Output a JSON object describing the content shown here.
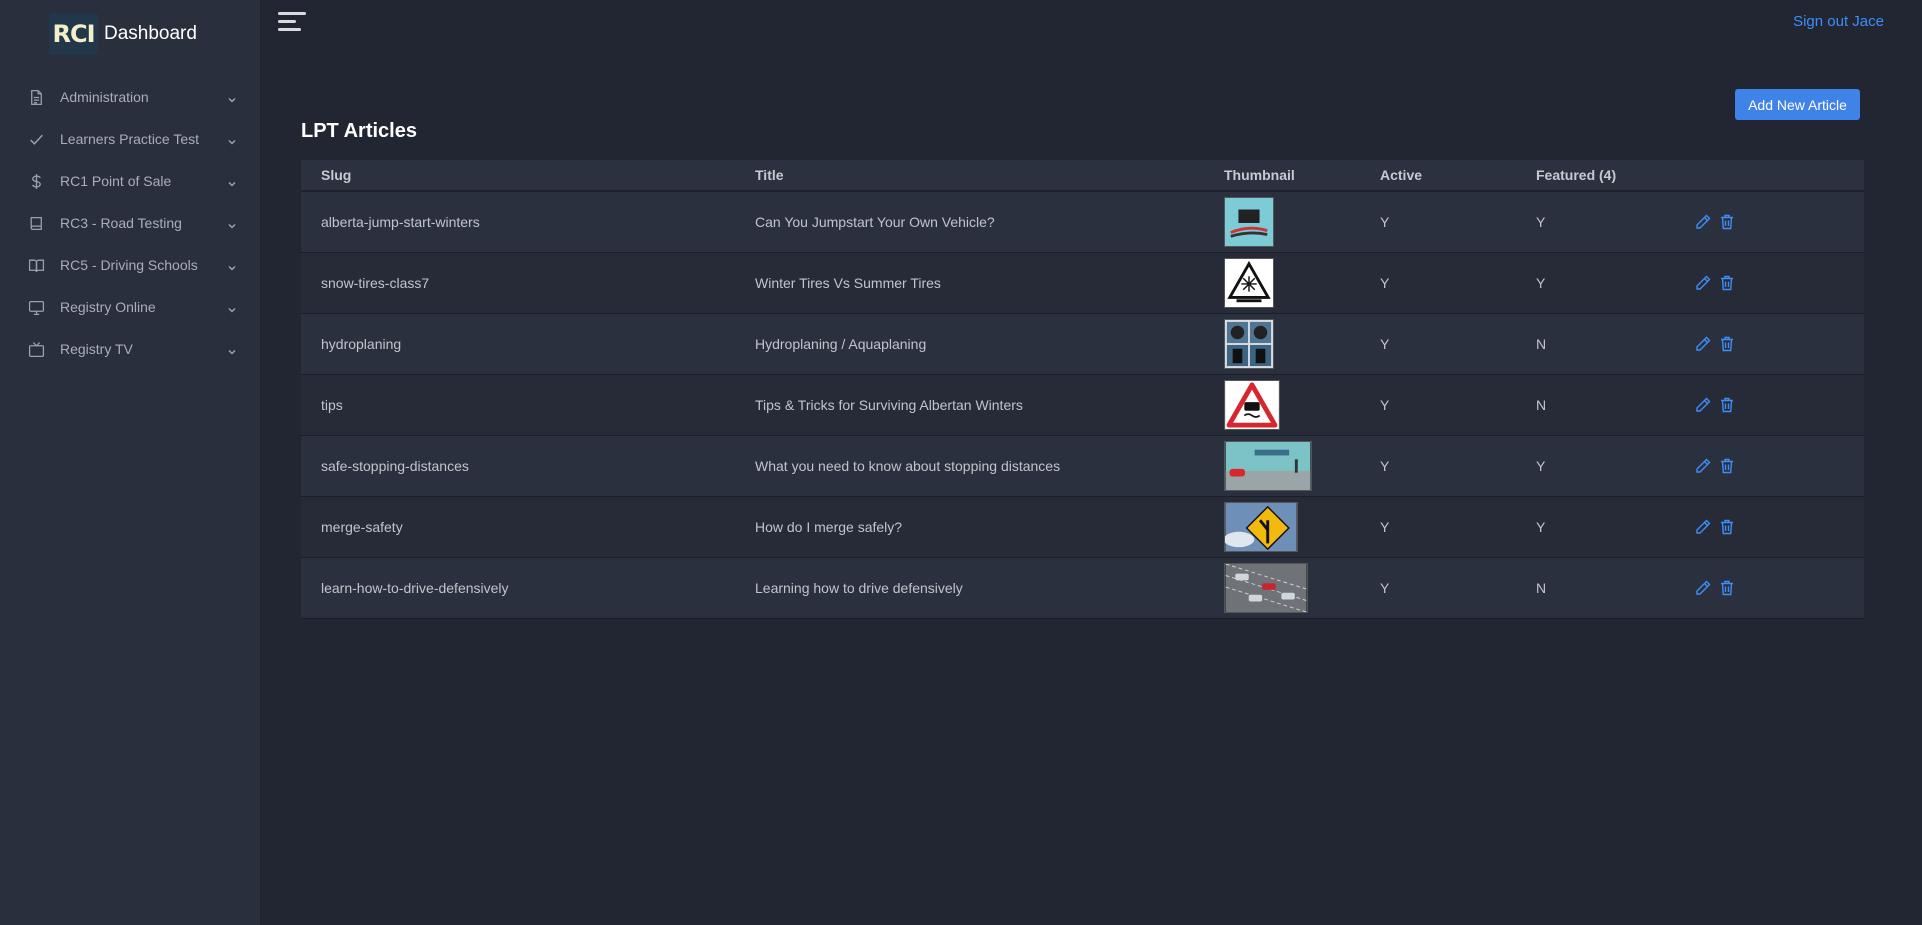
{
  "brand": {
    "logo_text": "RCI",
    "title": "Dashboard"
  },
  "header": {
    "sign_out": "Sign out Jace",
    "menu_icon": "hamburger-icon"
  },
  "sidebar": {
    "items": [
      {
        "label": "Administration",
        "icon": "document-icon"
      },
      {
        "label": "Learners Practice Test",
        "icon": "check-icon"
      },
      {
        "label": "RC1 Point of Sale",
        "icon": "dollar-icon"
      },
      {
        "label": "RC3 - Road Testing",
        "icon": "book-icon"
      },
      {
        "label": "RC5 - Driving Schools",
        "icon": "open-book-icon"
      },
      {
        "label": "Registry Online",
        "icon": "monitor-icon"
      },
      {
        "label": "Registry TV",
        "icon": "tv-icon"
      }
    ]
  },
  "main": {
    "title": "LPT Articles",
    "add_button": "Add New Article",
    "columns": {
      "slug": "Slug",
      "title": "Title",
      "thumbnail": "Thumbnail",
      "active": "Active",
      "featured": "Featured (4)"
    },
    "rows": [
      {
        "slug": "alberta-jump-start-winters",
        "title": "Can You Jumpstart Your Own Vehicle?",
        "active": "Y",
        "featured": "Y",
        "thumb": "jumper-cables-thumbnail",
        "thumb_color": "#7ecbd8"
      },
      {
        "slug": "snow-tires-class7",
        "title": "Winter Tires Vs Summer Tires",
        "active": "Y",
        "featured": "Y",
        "thumb": "winter-tires-sign-thumbnail",
        "thumb_color": "#ffffff"
      },
      {
        "slug": "hydroplaning",
        "title": "Hydroplaning / Aquaplaning",
        "active": "Y",
        "featured": "N",
        "thumb": "tires-grid-thumbnail",
        "thumb_color": "#5a7f9c"
      },
      {
        "slug": "tips",
        "title": "Tips & Tricks for Surviving Albertan Winters",
        "active": "Y",
        "featured": "N",
        "thumb": "slippery-road-sign-thumbnail",
        "thumb_color": "#ffffff"
      },
      {
        "slug": "safe-stopping-distances",
        "title": "What you need to know about stopping distances",
        "active": "Y",
        "featured": "Y",
        "thumb": "stopping-distance-thumbnail",
        "thumb_color": "#7cc3c8"
      },
      {
        "slug": "merge-safety",
        "title": "How do I merge safely?",
        "active": "Y",
        "featured": "Y",
        "thumb": "merge-sign-thumbnail",
        "thumb_color": "#6d8fb8"
      },
      {
        "slug": "learn-how-to-drive-defensively",
        "title": "Learning how to drive defensively",
        "active": "Y",
        "featured": "N",
        "thumb": "highway-cars-thumbnail",
        "thumb_color": "#6f7377"
      }
    ],
    "edit_icon": "pencil-icon",
    "delete_icon": "trash-icon"
  },
  "colors": {
    "accent": "#3f83e8",
    "link": "#3d8ef8",
    "background": "#222632",
    "sidebar": "#2a2f3e"
  }
}
